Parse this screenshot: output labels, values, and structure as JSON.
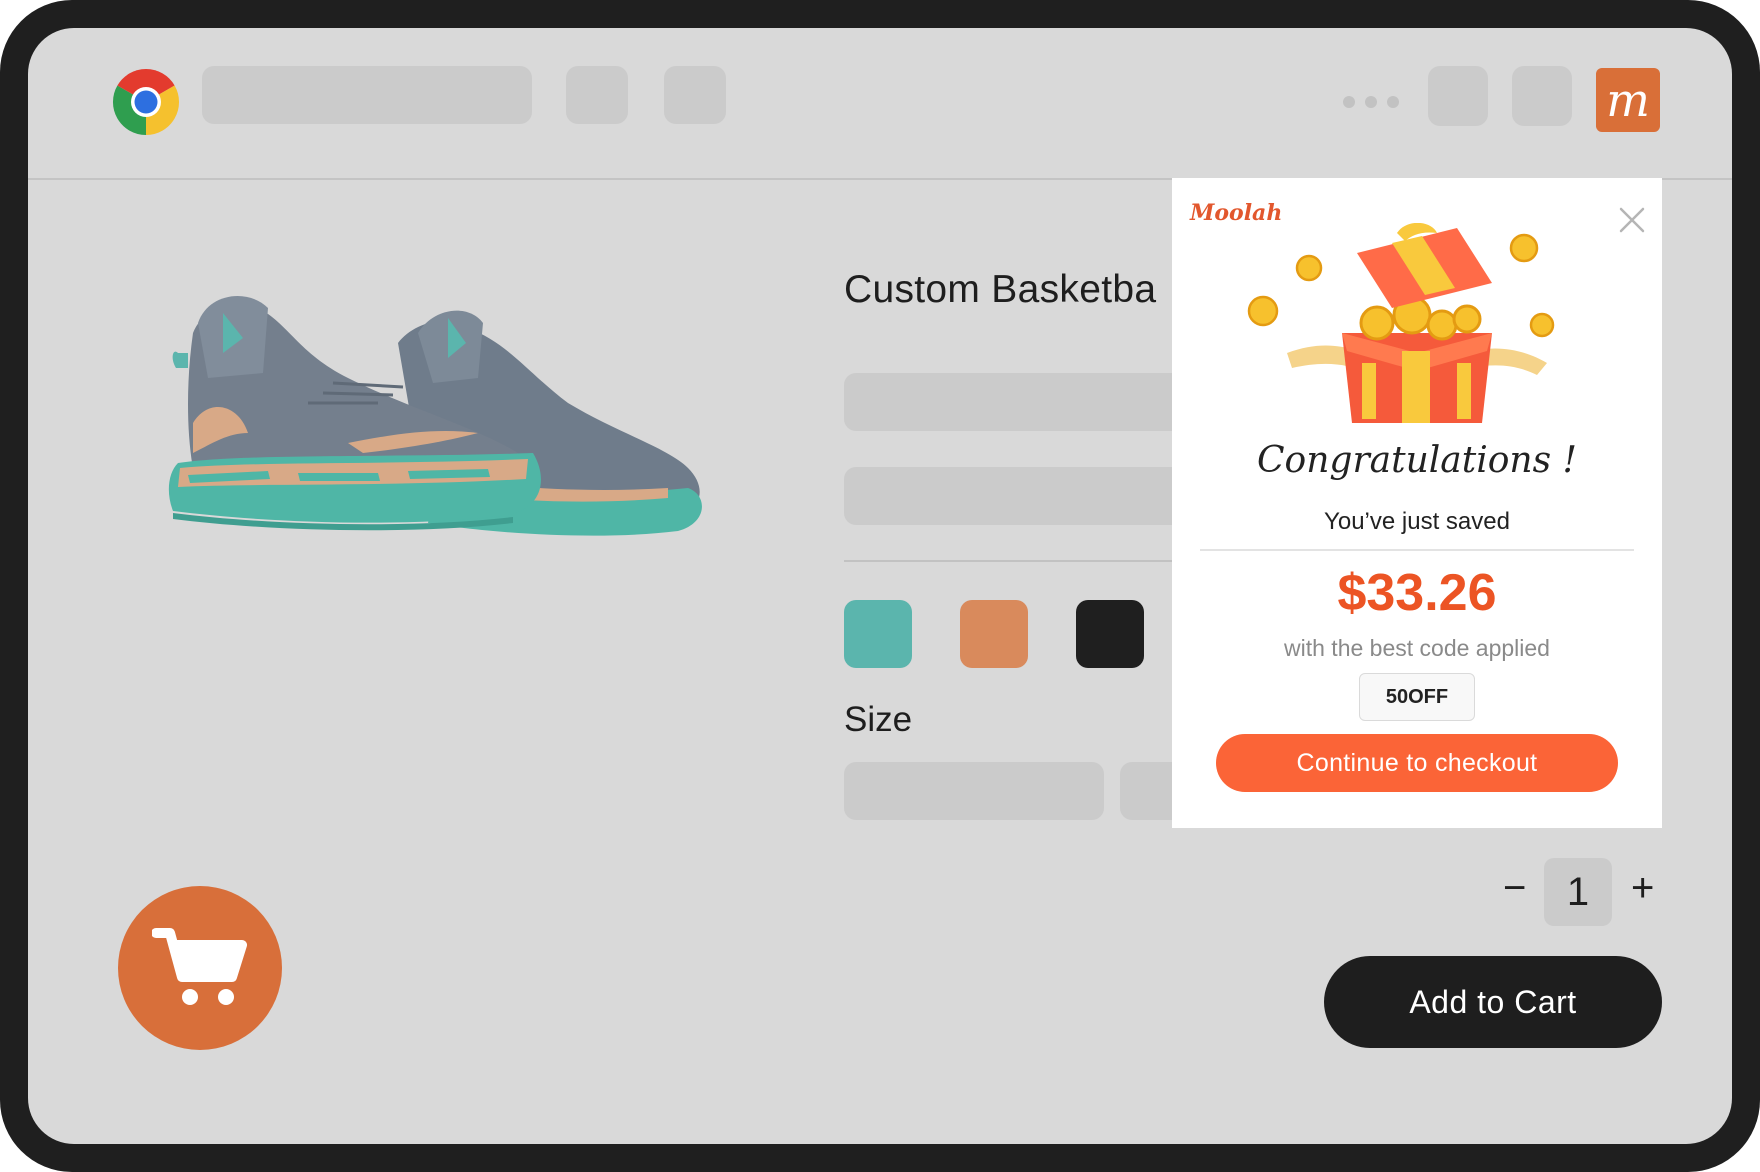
{
  "browser": {
    "icons": [
      "chrome-logo",
      "moolah-extension-icon"
    ],
    "extension_icon_glyph": "m",
    "colors": {
      "extension": "#d96f38"
    }
  },
  "product": {
    "title": "Custom Basketba",
    "size_label": "Size",
    "swatch_colors": [
      "#5bb5ad",
      "#d98a5c",
      "#1f1f1f"
    ],
    "quantity": "1",
    "qty_minus": "−",
    "qty_plus": "+",
    "add_to_cart_label": "Add to Cart",
    "colors": {
      "cart_fab": "#d86f3a",
      "add_to_cart_bg": "#1e1e1e"
    }
  },
  "popup": {
    "brand": "Moolah",
    "title": "Congratulations !",
    "subtitle": "You’ve just saved",
    "amount": "$33.26",
    "note": "with the best code applied",
    "code": "50OFF",
    "cta_label": "Continue to checkout",
    "colors": {
      "amount": "#ec5424",
      "cta": "#fb6437"
    }
  }
}
